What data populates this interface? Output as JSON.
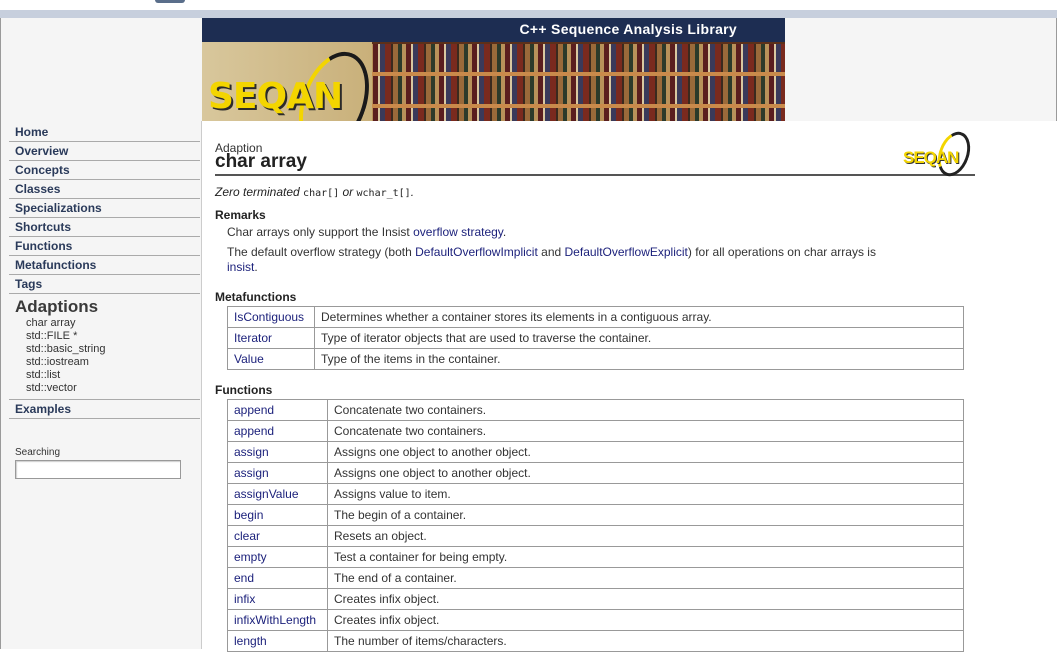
{
  "banner": {
    "title": "C++ Sequence Analysis Library",
    "logo_text": "SEQAN"
  },
  "sidebar": {
    "nav": [
      "Home",
      "Overview",
      "Concepts",
      "Classes",
      "Specializations",
      "Shortcuts",
      "Functions",
      "Metafunctions",
      "Tags"
    ],
    "section_title": "Adaptions",
    "adaptions": [
      "char array",
      "std::FILE *",
      "std::basic_string",
      "std::iostream",
      "std::list",
      "std::vector"
    ],
    "examples": "Examples",
    "search_label": "Searching",
    "search_value": ""
  },
  "page": {
    "kind": "Adaption",
    "title": "char array",
    "mini_logo": "SEQAN",
    "summary": {
      "prefix": "Zero terminated ",
      "code1": "char[]",
      "mid": " or ",
      "code2": "wchar_t[]",
      "suffix": "."
    }
  },
  "remarks": {
    "heading": "Remarks",
    "line1_text": "Char arrays only support the Insist ",
    "line1_link": "overflow strategy",
    "line1_end": ".",
    "line2_text1": "The default overflow strategy (both ",
    "line2_link1": "DefaultOverflowImplicit",
    "line2_text2": " and ",
    "line2_link2": "DefaultOverflowExplicit",
    "line2_text3": ") for all operations on char arrays is",
    "line2_link3": "insist",
    "line2_end": "."
  },
  "metafunctions": {
    "heading": "Metafunctions",
    "rows": [
      {
        "name": "IsContiguous",
        "desc": "Determines whether a container stores its elements in a contiguous array."
      },
      {
        "name": "Iterator",
        "desc": "Type of iterator objects that are used to traverse the container."
      },
      {
        "name": "Value",
        "desc": "Type of the items in the container."
      }
    ]
  },
  "functions": {
    "heading": "Functions",
    "rows": [
      {
        "name": "append",
        "desc": "Concatenate two containers."
      },
      {
        "name": "append",
        "desc": "Concatenate two containers."
      },
      {
        "name": "assign",
        "desc": "Assigns one object to another object."
      },
      {
        "name": "assign",
        "desc": "Assigns one object to another object."
      },
      {
        "name": "assignValue",
        "desc": "Assigns value to item."
      },
      {
        "name": "begin",
        "desc": "The begin of a container."
      },
      {
        "name": "clear",
        "desc": "Resets an object."
      },
      {
        "name": "empty",
        "desc": "Test a container for being empty."
      },
      {
        "name": "end",
        "desc": "The end of a container."
      },
      {
        "name": "infix",
        "desc": "Creates infix object."
      },
      {
        "name": "infixWithLength",
        "desc": "Creates infix object."
      },
      {
        "name": "length",
        "desc": "The number of items/characters."
      }
    ]
  }
}
